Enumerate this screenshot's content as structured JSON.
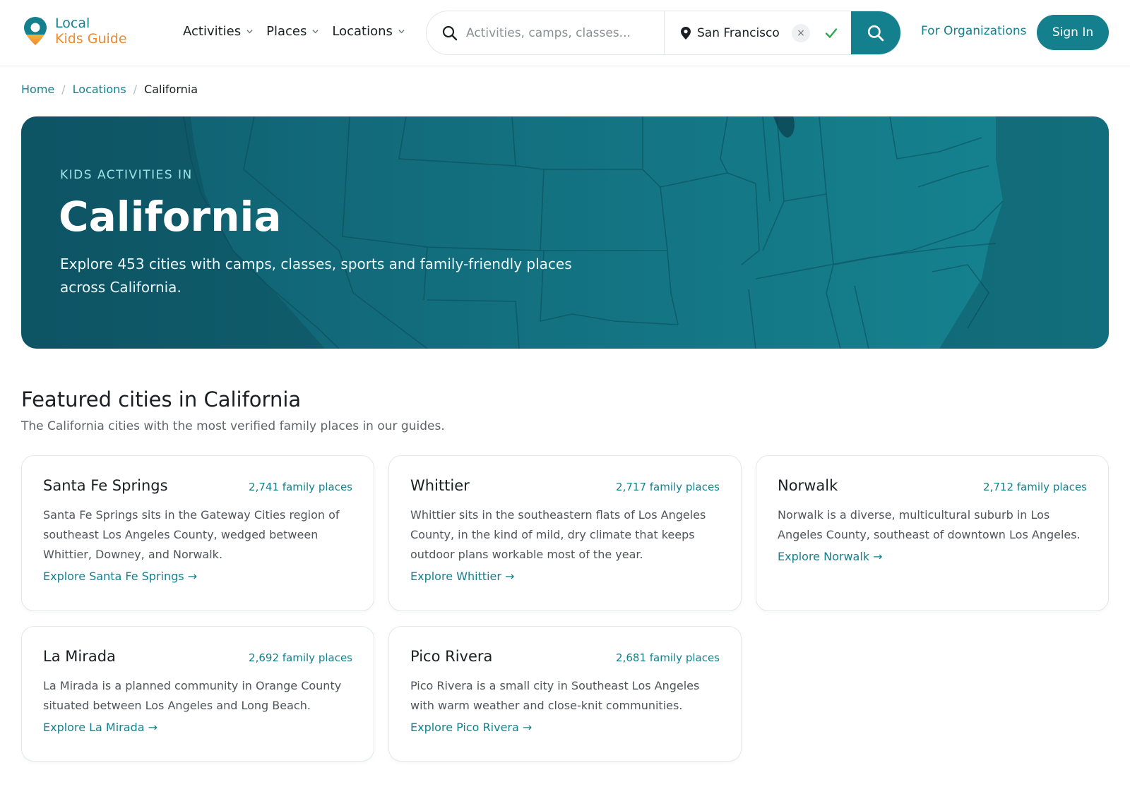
{
  "brand": {
    "line1": "Local",
    "line2": "Kids Guide"
  },
  "nav": [
    {
      "label": "Activities"
    },
    {
      "label": "Places"
    },
    {
      "label": "Locations"
    }
  ],
  "search": {
    "keyword_placeholder": "Activities, camps, classes...",
    "location_value": "San Francisco",
    "clear_label": "×"
  },
  "header": {
    "org_link": "For Organizations",
    "signin": "Sign In"
  },
  "breadcrumb": {
    "home": "Home",
    "sep": "/",
    "locations": "Locations",
    "current": "California"
  },
  "hero": {
    "eyebrow": "KIDS ACTIVITIES IN",
    "title": "California",
    "description": "Explore 453 cities with camps, classes, sports and family-friendly places across California."
  },
  "featured": {
    "title": "Featured cities in California",
    "subtitle": "The California cities with the most verified family places in our guides.",
    "cards": [
      {
        "name": "Santa Fe Springs",
        "count": "2,741 family places",
        "description": "Santa Fe Springs sits in the Gateway Cities region of southeast Los Angeles County, wedged between Whittier, Downey, and Norwalk.",
        "link": "Explore Santa Fe Springs →"
      },
      {
        "name": "Whittier",
        "count": "2,717 family places",
        "description": "Whittier sits in the southeastern flats of Los Angeles County, in the kind of mild, dry climate that keeps outdoor plans workable most of the year.",
        "link": "Explore Whittier →"
      },
      {
        "name": "Norwalk",
        "count": "2,712 family places",
        "description": "Norwalk is a diverse, multicultural suburb in Los Angeles County, southeast of downtown Los Angeles.",
        "link": "Explore Norwalk →"
      },
      {
        "name": "La Mirada",
        "count": "2,692 family places",
        "description": "La Mirada is a planned community in Orange County situated between Los Angeles and Long Beach.",
        "link": "Explore La Mirada →"
      },
      {
        "name": "Pico Rivera",
        "count": "2,681 family places",
        "description": "Pico Rivera is a small city in Southeast Los Angeles with warm weather and close-knit communities.",
        "link": "Explore Pico Rivera →"
      }
    ]
  },
  "colors": {
    "brand_teal": "#14808d",
    "brand_orange": "#f08a2c",
    "hero_dark": "#0f5d6e"
  }
}
